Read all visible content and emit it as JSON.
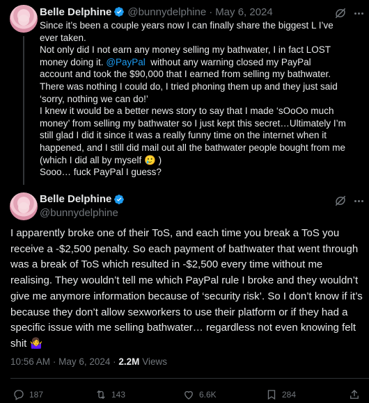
{
  "tweet1": {
    "author_name": "Belle Delphine",
    "handle": "@bunnydelphine",
    "separator": "·",
    "date": "May 6, 2024",
    "text_part1": "Since it’s been a couple years now I can finally share the biggest L I’ve ever taken.\nNot only did I not earn any money selling my bathwater, I in fact LOST money doing it. ",
    "mention": "@PayPal",
    "text_part2": "  without any warning closed my PayPal account and took the $90,000 that I earned from selling my bathwater. There was nothing I could do, I tried phoning them up and they just said ‘sorry, nothing we can do!’\nI knew it would be a better news story to say that I made ‘sOoOo much money’ from selling my bathwater so I just kept this secret…Ultimately I’m still glad I did it since it was a really funny time on the internet when it happened, and I still did mail out all the bathwater people bought from me (which I did all by myself ",
    "emoji": "🥲",
    "text_part3": " )\nSooo… fuck PayPal I guess?"
  },
  "tweet2": {
    "author_name": "Belle Delphine",
    "handle": "@bunnydelphine",
    "text": "I apparently broke one of their ToS, and each time you break a ToS you receive a -$2,500 penalty. So each payment of bathwater that went through was a break of ToS which resulted in -$2,500 every time without me realising. They wouldn’t tell me which PayPal rule I broke and they wouldn’t give me anymore information because of ‘security risk’. So I don’t know if it’s because they don’t allow sexworkers to use their platform or if they had a specific issue with me selling bathwater… regardless not even knowing felt shit ",
    "emoji": "🤷‍♀️",
    "time": "10:56 AM",
    "meta_separator": "·",
    "date": "May 6, 2024",
    "views_count": "2.2M",
    "views_label": "Views"
  },
  "actions": {
    "replies": "187",
    "reposts": "143",
    "likes": "6.6K",
    "bookmarks": "284"
  },
  "colors": {
    "background": "#000000",
    "text": "#e7e9ea",
    "muted": "#71767b",
    "accent": "#1d9bf0",
    "divider": "#2f3336"
  },
  "icons": [
    "verified-badge-icon",
    "grok-icon",
    "more-icon",
    "reply-icon",
    "repost-icon",
    "like-icon",
    "views-icon",
    "bookmark-icon",
    "share-icon"
  ]
}
